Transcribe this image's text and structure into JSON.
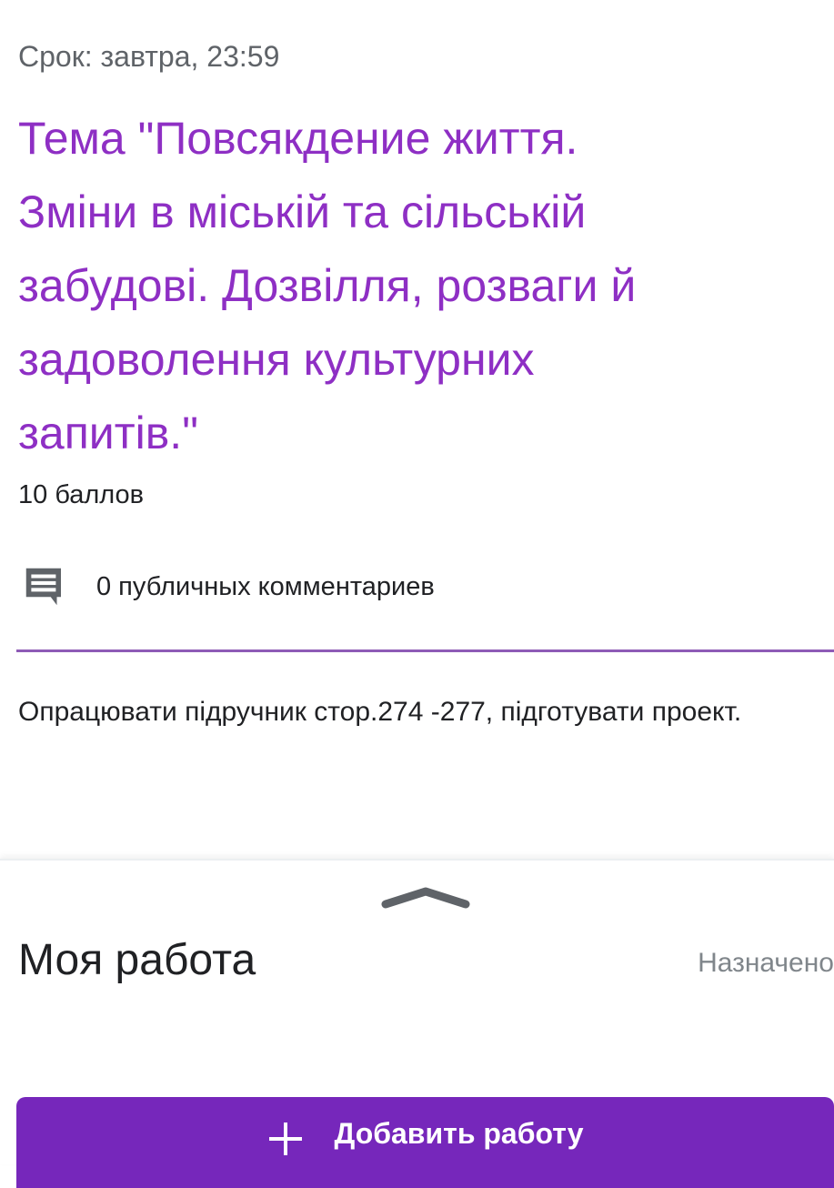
{
  "assignment": {
    "due": "Срок: завтра, 23:59",
    "title_lines": [
      "Тема \"Повсякдение життя.",
      "Зміни в міській та сільській",
      "забудові. Дозвілля, розваги  й",
      "задоволення культурних",
      "запитів.\""
    ],
    "points": "10 баллов",
    "comments_label": "0 публичных комментариев",
    "description": "Опрацювати підручник стор.274 -277, підготувати проект."
  },
  "my_work": {
    "title": "Моя работа",
    "status": "Назначено",
    "add_button_label": "Добавить работу"
  },
  "colors": {
    "accent": "#8e2fc4",
    "button": "#7627bb"
  }
}
